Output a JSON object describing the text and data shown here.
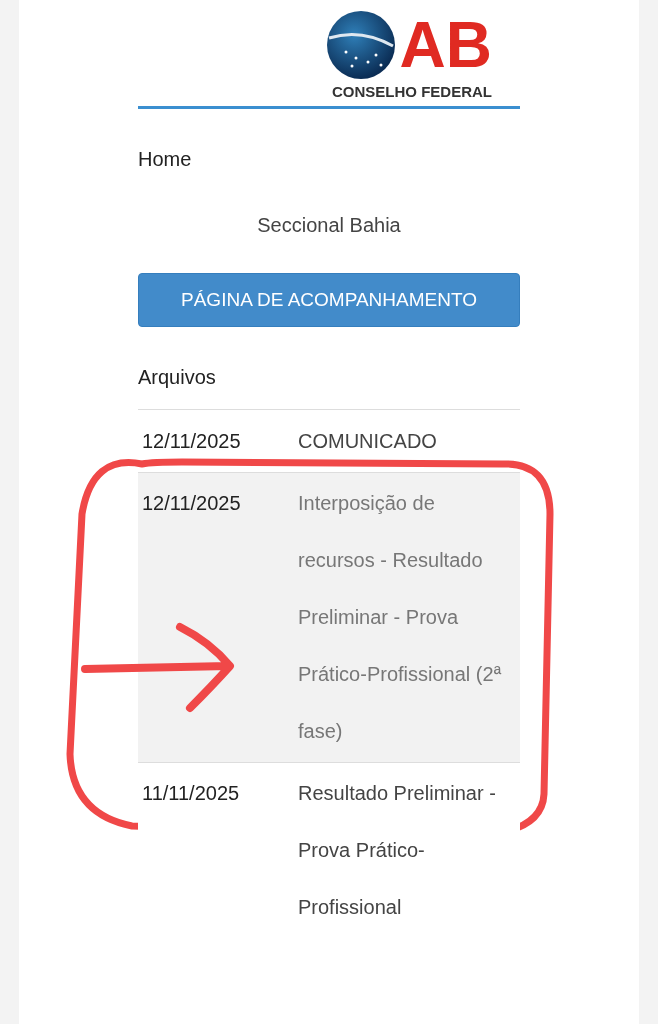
{
  "logo": {
    "letters": "AB",
    "subtitle": "CONSELHO FEDERAL"
  },
  "nav": {
    "home": "Home",
    "section": "Seccional Bahia",
    "button": "PÁGINA DE ACOMPANHAMENTO"
  },
  "files": {
    "heading": "Arquivos",
    "rows": [
      {
        "date": "12/11/2025",
        "title": "COMUNICADO",
        "selected": false,
        "annotated": false
      },
      {
        "date": "12/11/2025",
        "title": "Interposição de recursos - Resultado Preliminar - Prova Prático-Profissional (2ª fase)",
        "selected": true,
        "annotated": true
      },
      {
        "date": "11/11/2025",
        "title": "Resultado Preliminar - Prova Prático-Profissional",
        "selected": false,
        "annotated": false
      }
    ]
  }
}
